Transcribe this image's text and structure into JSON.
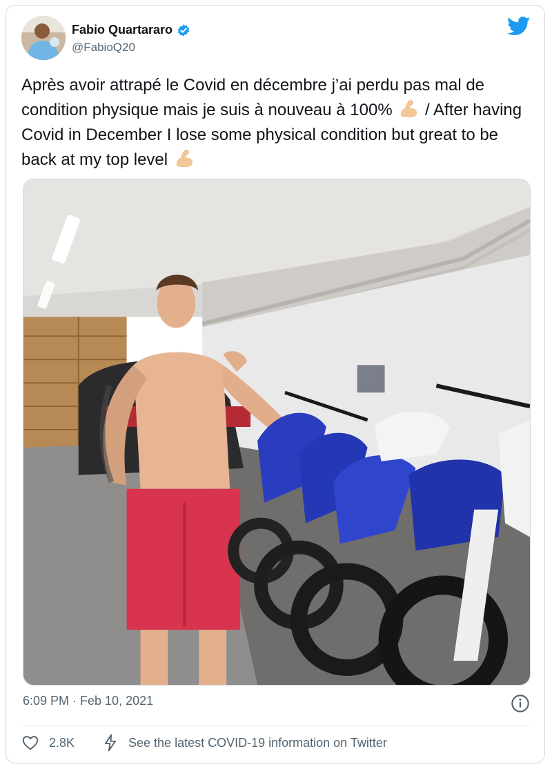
{
  "author": {
    "name": "Fabio Quartararo",
    "handle": "@FabioQ20",
    "verified": true
  },
  "tweet": {
    "text_fr": "Après avoir attrapé le Covid en décembre j’ai perdu pas mal de condition physique mais je suis à nouveau à 100%",
    "separator": "/",
    "text_en": "After having Covid in December I lose some physical condition but great to be back at my top level",
    "emoji": "flexed-biceps"
  },
  "timestamp": "6:09 PM · Feb 10, 2021",
  "actions": {
    "likes": "2.8K",
    "covid_link": "See the latest COVID-19 information on Twitter"
  },
  "colors": {
    "twitter_blue": "#1d9bf0",
    "text_primary": "#0f1419",
    "text_secondary": "#536471",
    "border": "#cfd9de",
    "shorts_red": "#d8344f",
    "bike_blue": "#2a3dbf"
  },
  "icons": [
    "twitter-bird-icon",
    "verified-badge-icon",
    "info-icon",
    "heart-icon",
    "bolt-icon",
    "flexed-biceps-emoji"
  ]
}
